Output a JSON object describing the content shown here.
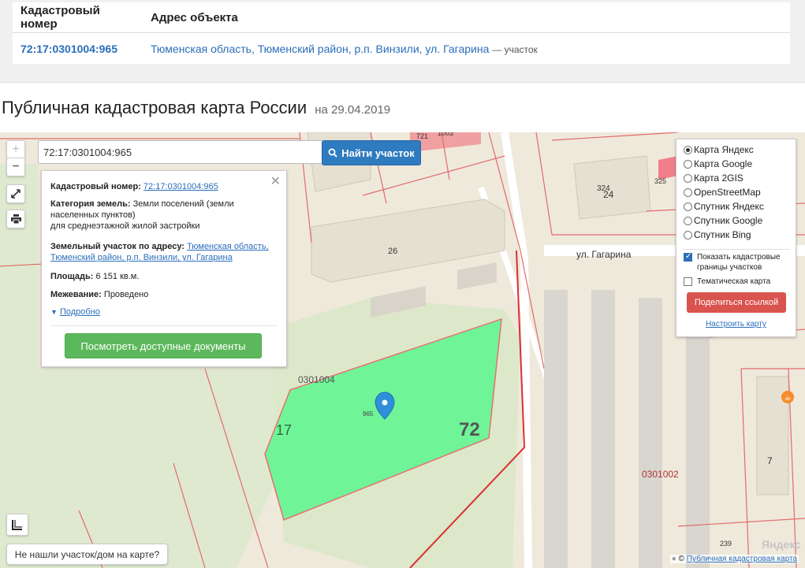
{
  "table": {
    "col_cadastral": "Кадастровый номер",
    "col_address": "Адрес объекта",
    "row": {
      "cadastral": "72:17:0301004:965",
      "address": "Тюменская область, Тюменский район, р.п. Винзили, ул. Гагарина",
      "address_suffix": "— участок"
    }
  },
  "heading": {
    "title": "Публичная кадастровая карта России",
    "date": "на 29.04.2019"
  },
  "map": {
    "zoom_in": "+",
    "zoom_out": "−",
    "search_value": "72:17:0301004:965",
    "search_button": "Найти участок",
    "labels": {
      "street": "ул. Гагарина",
      "house_26": "26",
      "house_324": "324",
      "house_24": "24",
      "house_325": "325",
      "house_721": "721",
      "house_1003": "1003",
      "house_7": "7",
      "house_239": "239",
      "quarter_0301004": "0301004",
      "quarter_0301002": "0301002",
      "parcel_965": "965",
      "district_17": "17",
      "district_72": "72",
      "map_brand": "Яндекс"
    },
    "not_found": "Не нашли участок/дом на карте?",
    "attribution_prefix": "© ",
    "attribution_link": "Публичная кадастровая карта"
  },
  "info": {
    "cad_label": "Кадастровый номер:",
    "cad_value": "72:17:0301004:965",
    "cat_label": "Категория земель:",
    "cat_value_1": "Земли поселений (земли",
    "cat_value_2": "населенных пунктов)",
    "cat_value_3": "для среднеэтажной жилой застройки",
    "addr_label": "Земельный участок по адресу:",
    "addr_value_1": "Тюменская область,",
    "addr_value_2": "Тюменский район, р.п. Винзили, ул. Гагарина",
    "area_label": "Площадь:",
    "area_value": "6 151 кв.м.",
    "survey_label": "Межевание:",
    "survey_value": "Проведено",
    "more_link": "Подробно",
    "docs_button": "Посмотреть доступные документы"
  },
  "layers": {
    "options": [
      "Карта Яндекс",
      "Карта Google",
      "Карта 2GIS",
      "OpenStreetMap",
      "Спутник Яндекс",
      "Спутник Google",
      "Спутник Bing"
    ],
    "selected": "Карта Яндекс",
    "show_borders_1": "Показать кадастровые",
    "show_borders_2": "границы участков",
    "show_borders_checked": true,
    "thematic": "Тематическая карта",
    "thematic_checked": false,
    "share_button": "Поделиться ссылкой",
    "setup_link": "Настроить карту"
  },
  "colors": {
    "accent": "#2f7bc0",
    "success": "#5cb85c",
    "danger": "#d9534f",
    "parcel": "#6ff598",
    "boundary": "#e74c4c"
  },
  "icons": [
    "search-icon",
    "fullscreen-icon",
    "print-icon",
    "close-icon",
    "caret-down-icon",
    "map-pin-icon",
    "ruler-icon",
    "food-icon"
  ]
}
